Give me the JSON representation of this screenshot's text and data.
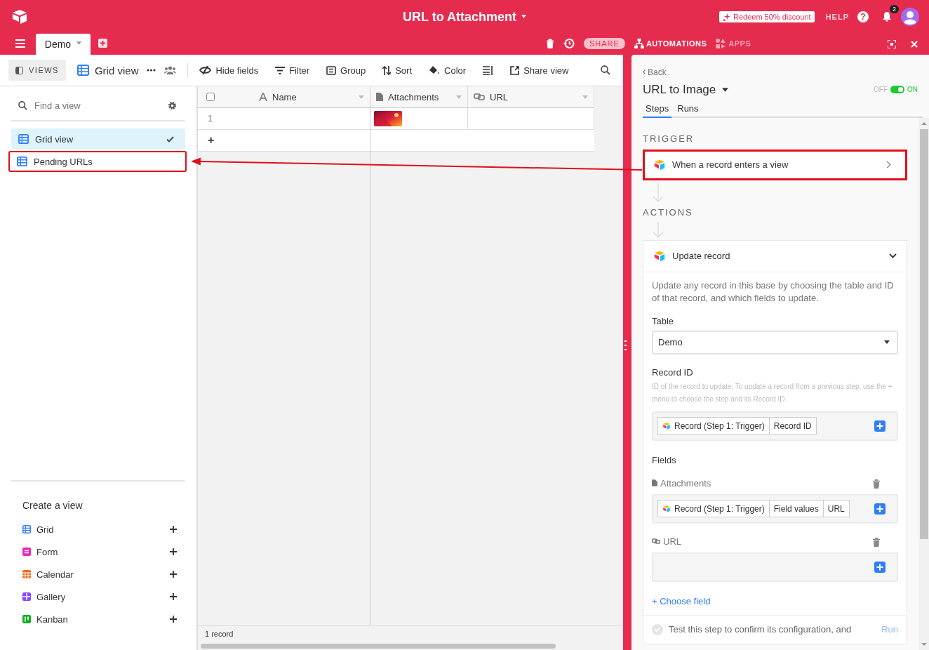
{
  "topbar": {
    "title": "URL to Attachment",
    "redeem": "Redeem 50% discount",
    "help": "HELP",
    "help_icon": "?",
    "notification_count": "2"
  },
  "tabs": [
    {
      "label": "Demo",
      "selected": true
    }
  ],
  "base_actions": {
    "share": "SHARE",
    "automations": "AUTOMATIONS",
    "apps": "APPS"
  },
  "view_bar": {
    "views_button": "VIEWS",
    "current_view": "Grid view",
    "actions": [
      {
        "kind": "hide",
        "label": "Hide fields"
      },
      {
        "kind": "filter",
        "label": "Filter"
      },
      {
        "kind": "group",
        "label": "Group"
      },
      {
        "kind": "sort",
        "label": "Sort"
      },
      {
        "kind": "color",
        "label": "Color"
      },
      {
        "kind": "row-height"
      },
      {
        "kind": "share",
        "label": "Share view"
      }
    ]
  },
  "sidebar": {
    "search_placeholder": "Find a view",
    "views": [
      {
        "name": "Grid view",
        "selected": true,
        "highlighted": false
      },
      {
        "name": "Pending URLs",
        "selected": false,
        "highlighted": true
      }
    ],
    "create_title": "Create a view",
    "create_items": [
      {
        "kind": "grid",
        "name": "Grid",
        "color": "#2d7ff9"
      },
      {
        "kind": "form",
        "name": "Form",
        "color": "#e929ba"
      },
      {
        "kind": "calendar",
        "name": "Calendar",
        "color": "#f56e1e"
      },
      {
        "kind": "gallery",
        "name": "Gallery",
        "color": "#8b46ff"
      },
      {
        "kind": "kanban",
        "name": "Kanban",
        "color": "#11af22"
      }
    ]
  },
  "grid": {
    "columns": [
      {
        "kind": "text",
        "name": "Name"
      },
      {
        "kind": "attachment",
        "name": "Attachments"
      },
      {
        "kind": "url",
        "name": "URL"
      }
    ],
    "rows": [
      {
        "number": "1",
        "has_attachment": true
      }
    ],
    "add_row": "+",
    "footer": "1 record"
  },
  "automation": {
    "back": "Back",
    "title": "URL to Image",
    "toggle": {
      "off_label": "OFF",
      "on_label": "ON",
      "on": true
    },
    "tabs": [
      {
        "label": "Steps",
        "selected": true
      },
      {
        "label": "Runs",
        "selected": false
      }
    ],
    "trigger_heading": "TRIGGER",
    "trigger": {
      "text": "When a record enters a view",
      "highlighted": true
    },
    "actions_heading": "ACTIONS",
    "action": {
      "title": "Update record",
      "expanded": true,
      "description": "Update any record in this base by choosing the table and ID of that record, and which fields to update.",
      "table_label": "Table",
      "table_value": "Demo",
      "record_id_label": "Record ID",
      "record_id_help": "ID of the record to update. To update a record from a previous step, use the + menu to choose the step and its Record ID.",
      "record_id_tokens": [
        {
          "kind": "step",
          "label": "Record (Step 1: Trigger)"
        },
        {
          "kind": "value",
          "label": "Record ID"
        }
      ],
      "fields_label": "Fields",
      "fields": [
        {
          "kind": "attachment",
          "name": "Attachments",
          "tokens": [
            {
              "kind": "step",
              "label": "Record (Step 1: Trigger)"
            },
            {
              "kind": "value",
              "label": "Field values"
            },
            {
              "kind": "value",
              "label": "URL"
            }
          ]
        },
        {
          "kind": "url",
          "name": "URL"
        }
      ],
      "choose_field": "+ Choose field",
      "test_text": "Test this step to confirm its configuration, and",
      "run": "Run"
    }
  }
}
